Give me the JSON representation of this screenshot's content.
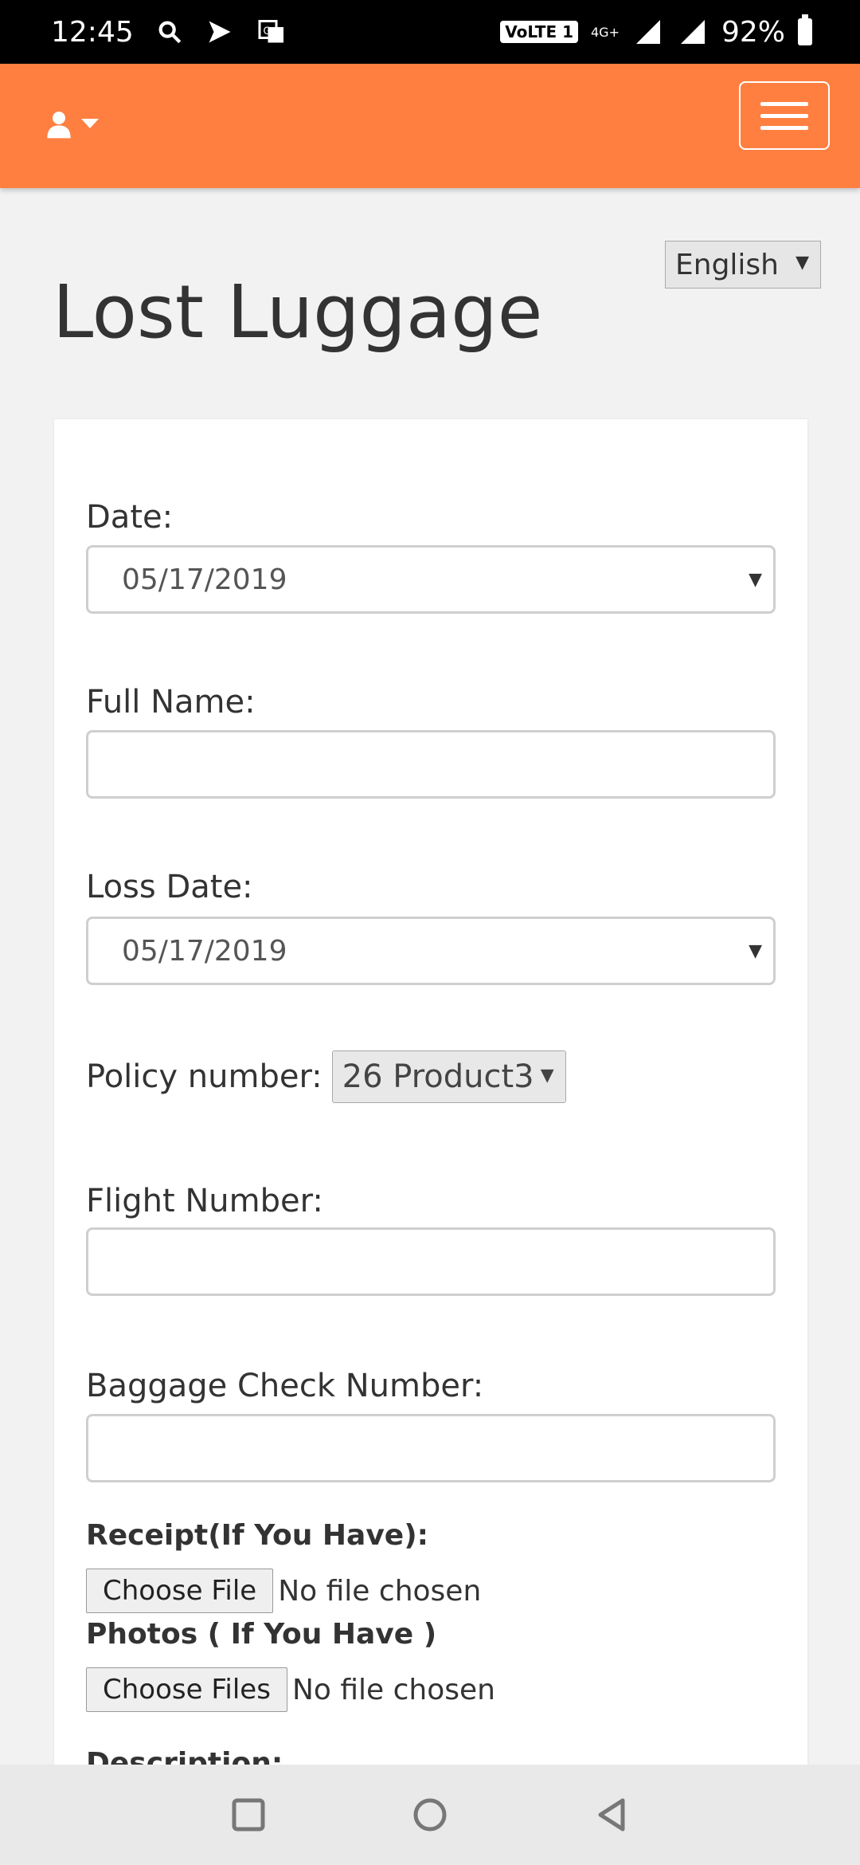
{
  "status_bar": {
    "time": "12:45",
    "volte_label": "VoLTE 1",
    "network": "4G+",
    "battery": "92%",
    "icons": [
      "search-icon",
      "send-icon",
      "translate-icon",
      "signal-icon",
      "battery-icon"
    ]
  },
  "header": {
    "icons": [
      "user-icon",
      "caret-down-icon",
      "hamburger-menu-icon"
    ]
  },
  "language_select": {
    "selected": "English"
  },
  "page": {
    "title": "Lost Luggage"
  },
  "form": {
    "date_label": "Date:",
    "date_value": "05/17/2019",
    "full_name_label": "Full Name:",
    "full_name_value": "",
    "loss_date_label": "Loss Date:",
    "loss_date_value": "05/17/2019",
    "policy_label": "Policy number:",
    "policy_value": "26 Product3",
    "flight_label": "Flight Number:",
    "flight_value": "",
    "baggage_label": "Baggage Check Number:",
    "baggage_value": "",
    "receipt_label": "Receipt(If You Have):",
    "receipt_button": "Choose File",
    "receipt_status": "No file chosen",
    "photos_label": "Photos ( If You Have )",
    "photos_button": "Choose Files",
    "photos_status": "No file chosen",
    "description_label": "Description:"
  },
  "nav_bar": {
    "icons": [
      "recents-square-icon",
      "home-circle-icon",
      "back-triangle-icon"
    ]
  },
  "colors": {
    "header": "#ff7f41",
    "status_bar": "#000000",
    "background": "#f2f2f3"
  }
}
